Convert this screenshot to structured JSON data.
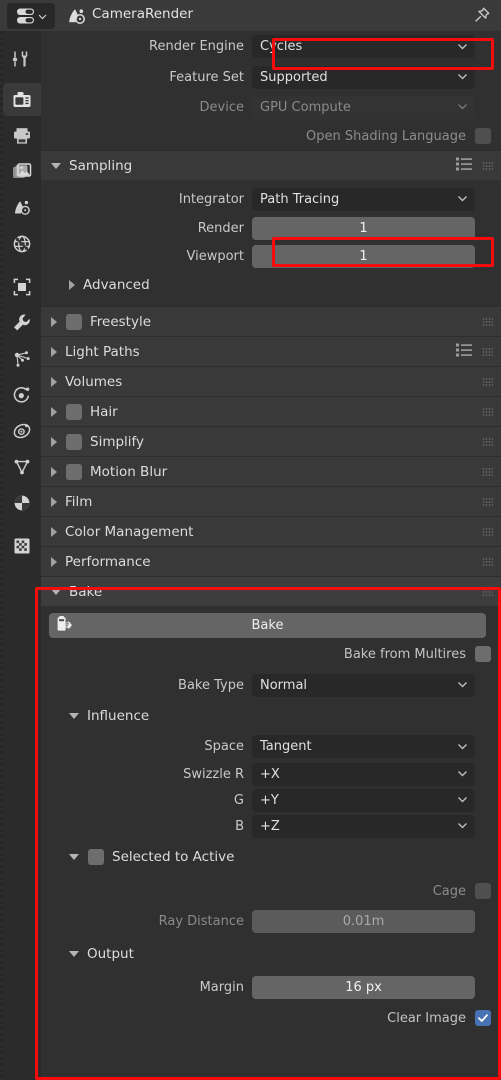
{
  "header": {
    "editor_type_icon": "editor-type-icon",
    "breadcrumb_icon": "render-properties-icon",
    "title": "CameraRender",
    "pin_icon": "pin-icon"
  },
  "tabs": [
    {
      "id": "tool",
      "icon": "tool-icon",
      "active": false
    },
    {
      "id": "render",
      "icon": "render-camera-back-icon",
      "active": true
    },
    {
      "id": "output",
      "icon": "printer-icon",
      "active": false
    },
    {
      "id": "view-layer",
      "icon": "images-icon",
      "active": false
    },
    {
      "id": "scene",
      "icon": "scene-cone-icon",
      "active": false
    },
    {
      "id": "world",
      "icon": "world-globe-icon",
      "active": false
    },
    {
      "id": "object",
      "icon": "object-square-icon",
      "active": false
    },
    {
      "id": "modifiers",
      "icon": "wrench-icon",
      "active": false
    },
    {
      "id": "particles",
      "icon": "particles-icon",
      "active": false
    },
    {
      "id": "physics",
      "icon": "physics-orbit-icon",
      "active": false
    },
    {
      "id": "constraints",
      "icon": "constraints-icon",
      "active": false
    },
    {
      "id": "data",
      "icon": "mesh-data-triangle-icon",
      "active": false
    },
    {
      "id": "material",
      "icon": "material-sphere-icon",
      "active": false
    },
    {
      "id": "texture",
      "icon": "texture-checker-icon",
      "active": false
    }
  ],
  "render_engine": {
    "label": "Render Engine",
    "value": "Cycles",
    "highlighted": true
  },
  "feature_set": {
    "label": "Feature Set",
    "value": "Supported"
  },
  "device": {
    "label": "Device",
    "value": "GPU Compute",
    "disabled": true
  },
  "osl": {
    "label": "Open Shading Language",
    "checked": false,
    "disabled": true
  },
  "sampling": {
    "title": "Sampling",
    "expanded": true,
    "integrator": {
      "label": "Integrator",
      "value": "Path Tracing"
    },
    "render": {
      "label": "Render",
      "value": "1",
      "highlighted": true
    },
    "viewport": {
      "label": "Viewport",
      "value": "1"
    },
    "advanced": {
      "title": "Advanced",
      "expanded": false
    }
  },
  "panels": [
    {
      "title": "Freestyle",
      "expanded": false,
      "checkbox": true,
      "checked": false,
      "list_icon": false
    },
    {
      "title": "Light Paths",
      "expanded": false,
      "checkbox": false,
      "list_icon": true
    },
    {
      "title": "Volumes",
      "expanded": false,
      "checkbox": false,
      "list_icon": false
    },
    {
      "title": "Hair",
      "expanded": false,
      "checkbox": true,
      "checked": false,
      "list_icon": false
    },
    {
      "title": "Simplify",
      "expanded": false,
      "checkbox": true,
      "checked": false,
      "list_icon": false
    },
    {
      "title": "Motion Blur",
      "expanded": false,
      "checkbox": true,
      "checked": false,
      "list_icon": false
    },
    {
      "title": "Film",
      "expanded": false,
      "checkbox": false,
      "list_icon": false
    },
    {
      "title": "Color Management",
      "expanded": false,
      "checkbox": false,
      "list_icon": false
    },
    {
      "title": "Performance",
      "expanded": false,
      "checkbox": false,
      "list_icon": false
    }
  ],
  "bake": {
    "title": "Bake",
    "expanded": true,
    "highlighted": true,
    "bake_button": {
      "label": "Bake",
      "icon": "bake-render-icon"
    },
    "bake_from_multires": {
      "label": "Bake from Multires",
      "checked": false
    },
    "bake_type": {
      "label": "Bake Type",
      "value": "Normal"
    },
    "influence": {
      "title": "Influence",
      "expanded": true,
      "space": {
        "label": "Space",
        "value": "Tangent"
      },
      "swizzle_r": {
        "label": "Swizzle R",
        "value": "+X"
      },
      "swizzle_g": {
        "label": "G",
        "value": "+Y"
      },
      "swizzle_b": {
        "label": "B",
        "value": "+Z"
      }
    },
    "selected_to_active": {
      "title": "Selected to Active",
      "expanded": true,
      "checked": false,
      "cage": {
        "label": "Cage",
        "checked": false,
        "disabled": true
      },
      "ray_distance": {
        "label": "Ray Distance",
        "value": "0.01m",
        "disabled": true
      }
    },
    "output": {
      "title": "Output",
      "expanded": true,
      "margin": {
        "label": "Margin",
        "value": "16 px"
      },
      "clear_image": {
        "label": "Clear Image",
        "checked": true
      }
    }
  },
  "colors": {
    "highlight": "#f50c0c",
    "checkbox_on": "#4772b3",
    "panel_header": "#393939",
    "background": "#303030",
    "field": "#282828",
    "slider": "#656565"
  }
}
